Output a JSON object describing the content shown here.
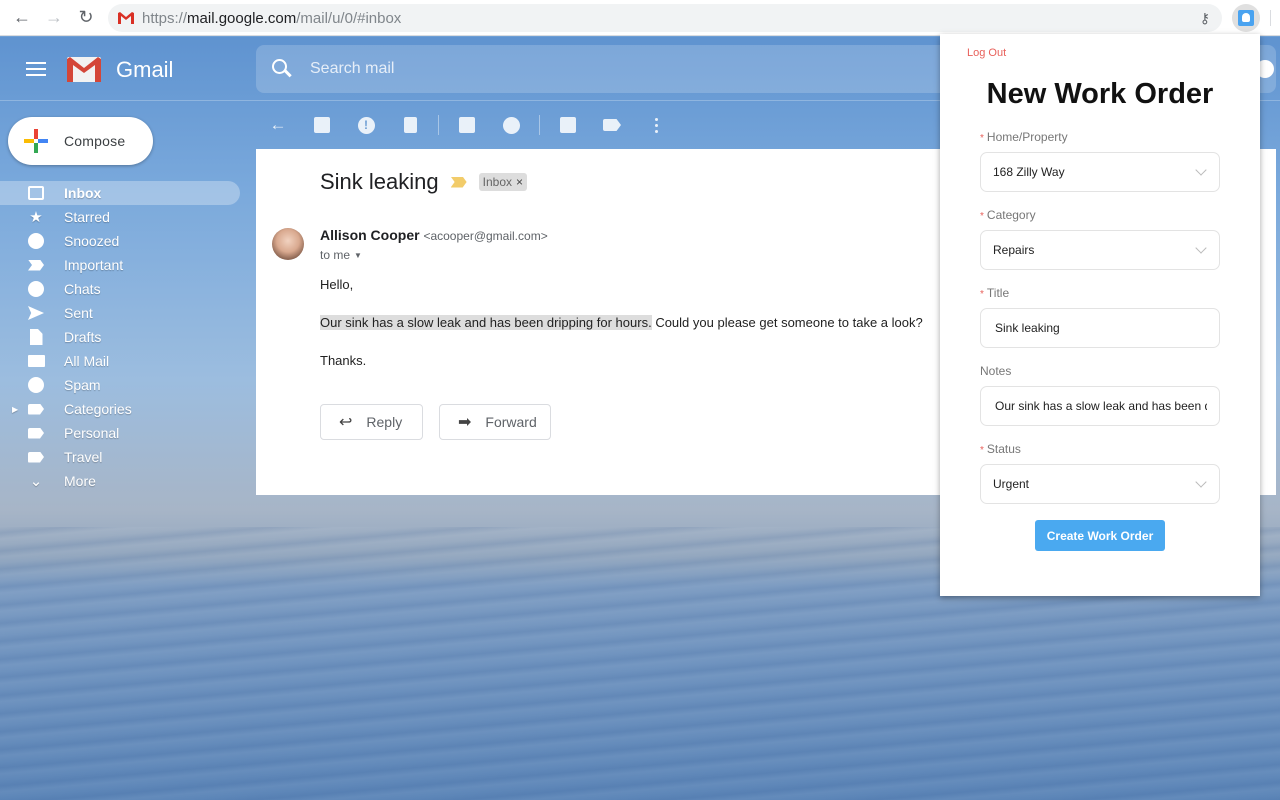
{
  "browser": {
    "url_scheme": "https://",
    "url_host": "mail.google.com",
    "url_path": "/mail/u/0/#inbox",
    "back_icon": "arrow-left-icon",
    "forward_icon": "arrow-right-icon",
    "reload_icon": "reload-icon",
    "key_icon": "key-icon",
    "extension_icon": "work-order-extension-icon"
  },
  "gmail": {
    "brand": "Gmail",
    "search_placeholder": "Search mail",
    "compose_label": "Compose",
    "sidebar": [
      {
        "label": "Inbox",
        "icon": "inbox-icon",
        "active": true
      },
      {
        "label": "Starred",
        "icon": "star-icon"
      },
      {
        "label": "Snoozed",
        "icon": "clock-icon"
      },
      {
        "label": "Important",
        "icon": "important-icon"
      },
      {
        "label": "Chats",
        "icon": "chat-icon"
      },
      {
        "label": "Sent",
        "icon": "send-icon"
      },
      {
        "label": "Drafts",
        "icon": "draft-icon"
      },
      {
        "label": "All Mail",
        "icon": "mail-icon"
      },
      {
        "label": "Spam",
        "icon": "spam-icon"
      },
      {
        "label": "Categories",
        "icon": "label-icon",
        "expandable": true
      },
      {
        "label": "Personal",
        "icon": "label-icon"
      },
      {
        "label": "Travel",
        "icon": "label-icon"
      },
      {
        "label": "More",
        "icon": "chevron-down-icon"
      }
    ],
    "toolbar": [
      "back-icon",
      "archive-icon",
      "report-spam-icon",
      "delete-icon",
      "mark-unread-icon",
      "snooze-icon",
      "move-to-icon",
      "label-icon",
      "more-vert-icon"
    ],
    "message": {
      "subject": "Sink leaking",
      "label_chip": "Inbox",
      "label_chip_close": "×",
      "sender_name": "Allison Cooper",
      "sender_email": "<acooper@gmail.com>",
      "recipient": "to me",
      "greeting": "Hello,",
      "body_highlighted": "Our sink has a slow leak and has been dripping for hours.",
      "body_rest": " Could you please get someone to take a look?",
      "signoff": "Thanks.",
      "reply_label": "Reply",
      "forward_label": "Forward"
    }
  },
  "popup": {
    "logout_label": "Log Out",
    "title": "New Work Order",
    "required_marker": "*",
    "fields": {
      "property": {
        "label": "Home/Property",
        "value": "168 Zilly Way",
        "required": true
      },
      "category": {
        "label": "Category",
        "value": "Repairs",
        "required": true
      },
      "title": {
        "label": "Title",
        "value": "Sink leaking",
        "required": true
      },
      "notes": {
        "label": "Notes",
        "value": "Our sink has a slow leak and has been dripping for hours.",
        "required": false
      },
      "status": {
        "label": "Status",
        "value": "Urgent",
        "required": true
      }
    },
    "submit_label": "Create Work Order",
    "accent_color": "#4aa9f0",
    "logout_color": "#e8615b"
  }
}
